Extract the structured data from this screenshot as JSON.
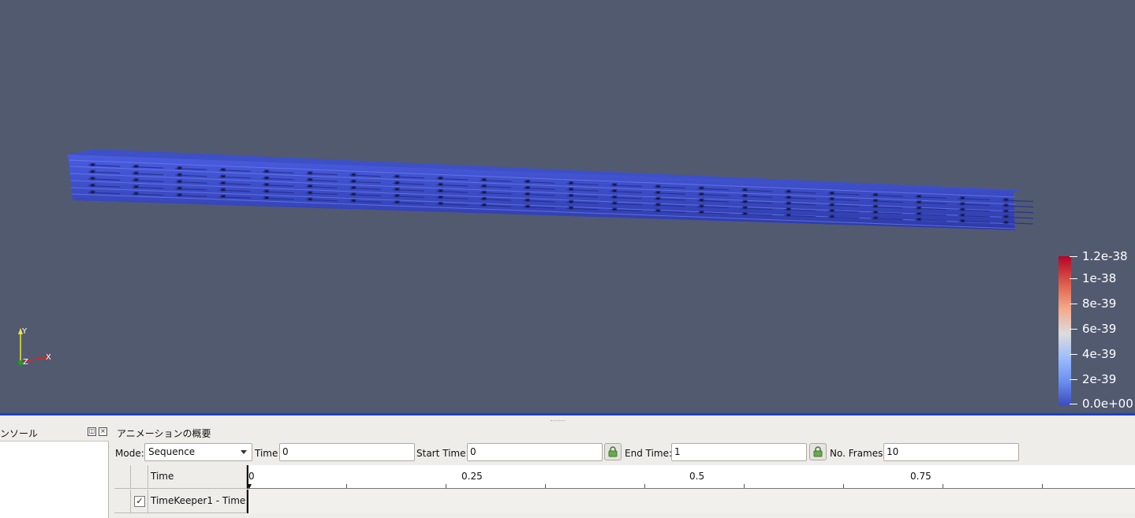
{
  "colorbar": {
    "ticks": [
      "1.2e-38",
      "1e-38",
      "8e-39",
      "6e-39",
      "4e-39",
      "2e-39",
      "0.0e+00"
    ]
  },
  "axes": {
    "y": "Y",
    "x": "X",
    "z": "Z"
  },
  "console": {
    "title": "ンソール"
  },
  "animation": {
    "title": "アニメーションの概要",
    "mode_label": "Mode:",
    "mode_value": "Sequence",
    "time_label": "Time",
    "time_value": "0",
    "start_label": "Start Time:",
    "start_value": "0",
    "end_label": "End Time:",
    "end_value": "1",
    "frames_label": "No. Frames:",
    "frames_value": "10",
    "timeline": {
      "header": "Time",
      "scale": [
        "0",
        "0.25",
        "0.5",
        "0.75"
      ],
      "track": "TimeKeeper1 - Time",
      "track_checked": "✓"
    }
  },
  "colors": {
    "background": "#525a70",
    "mesh": "#3a4cc0",
    "accent": "#1a3fd0"
  }
}
